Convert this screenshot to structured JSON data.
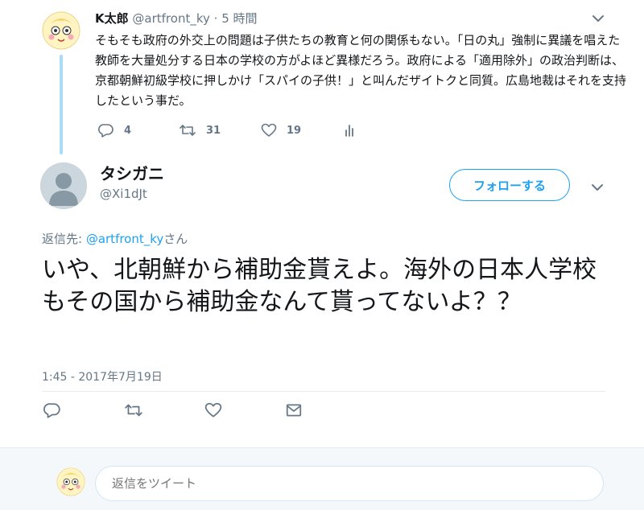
{
  "parent": {
    "name": "K太郎",
    "handle": "@artfront_ky",
    "separator": "·",
    "time": "5 時間",
    "text": "そもそも政府の外交上の問題は子供たちの教育と何の関係もない。「日の丸」強制に異議を唱えた教師を大量処分する日本の学校の方がよほど異様だろう。政府による「適用除外」の政治判断は、京都朝鮮初級学校に押しかけ「スパイの子供！」と叫んだザイトクと同質。広島地裁はそれを支持したという事だ。",
    "replies": "4",
    "retweets": "31",
    "likes": "19"
  },
  "main": {
    "name": "タシガニ",
    "handle": "@Xi1dJt",
    "follow_label": "フォローする",
    "reply_prefix": "返信先: ",
    "reply_mention": "@artfront_ky",
    "reply_suffix": "さん",
    "text": "いや、北朝鮮から補助金貰えよ。海外の日本人学校もその国から補助金なんて貰ってないよ？？",
    "timestamp": "1:45 - 2017年7月19日"
  },
  "reply_box": {
    "placeholder": "返信をツイート"
  },
  "colors": {
    "accent": "#1da1f2",
    "muted": "#657786",
    "thread_line": "#a9dcf6"
  }
}
